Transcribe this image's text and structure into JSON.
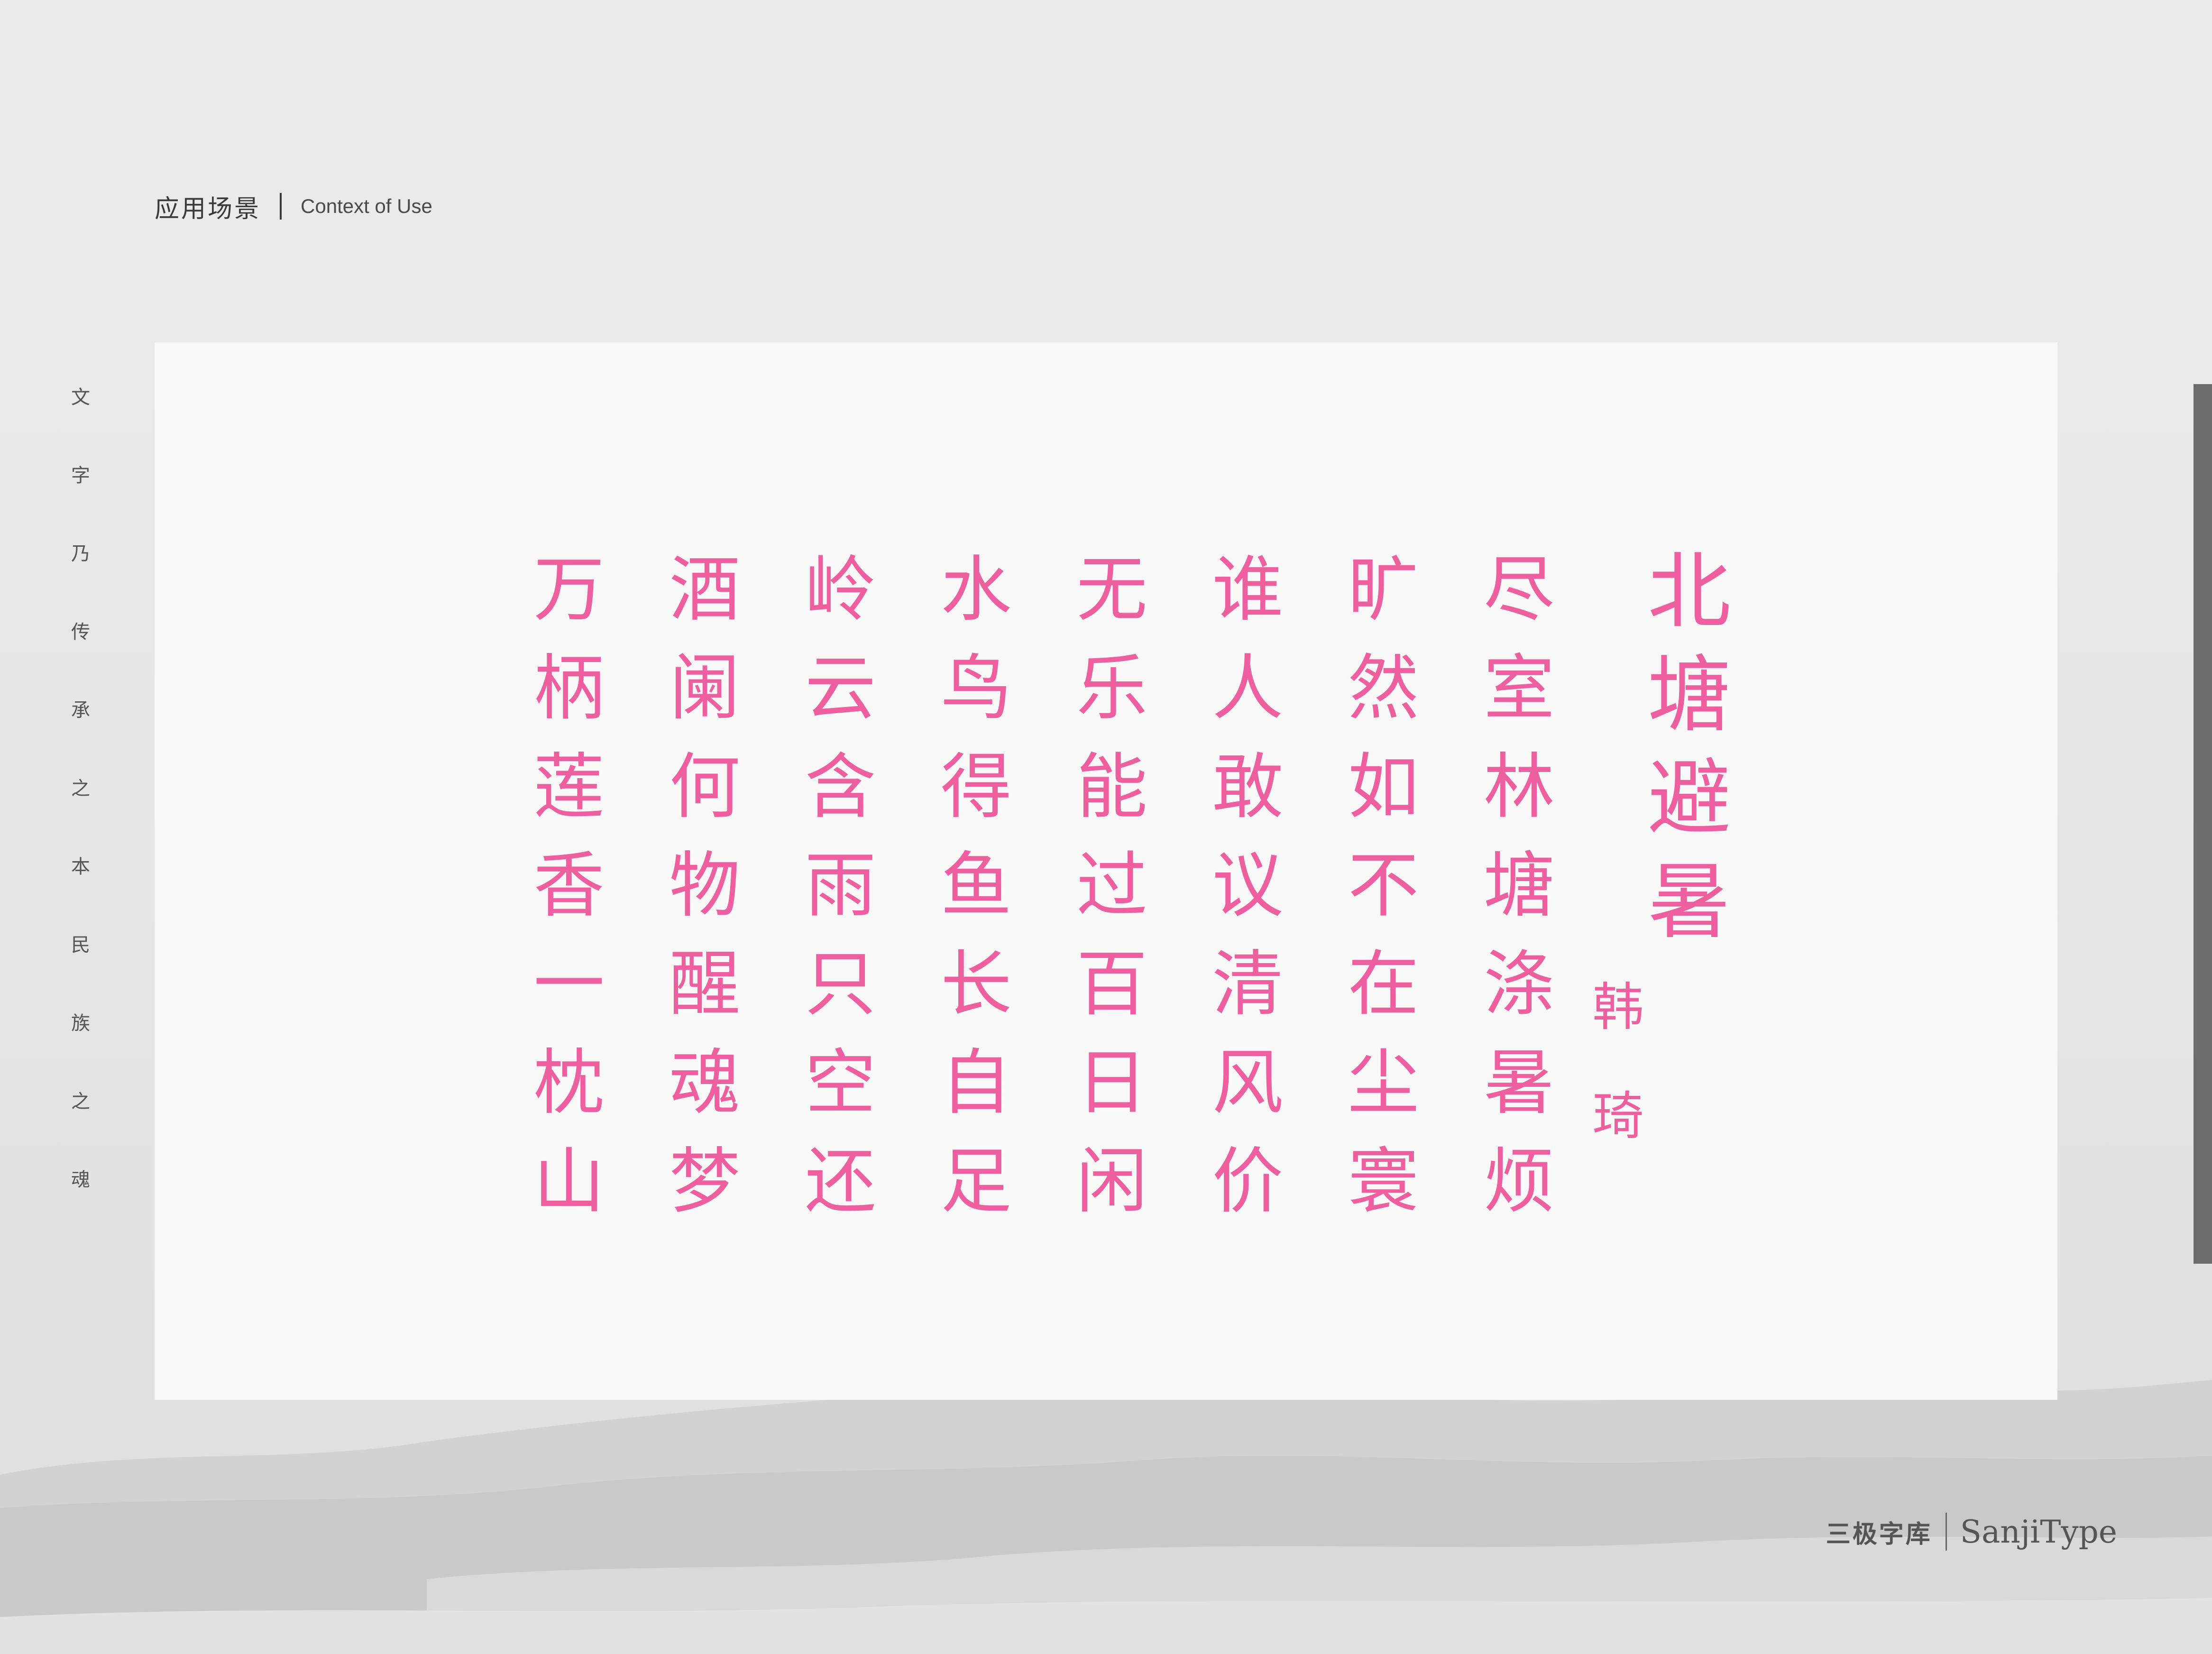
{
  "header": {
    "title_cn": "应用场景",
    "title_en": "Context of Use"
  },
  "vertical_motto": [
    "文",
    "字",
    "乃",
    "传",
    "承",
    "之",
    "本",
    "民",
    "族",
    "之",
    "魂"
  ],
  "poem": {
    "title": [
      "北",
      "塘",
      "避",
      "暑"
    ],
    "author": [
      "韩",
      "琦"
    ],
    "columns": [
      [
        "尽",
        "室",
        "林",
        "塘",
        "涤",
        "暑",
        "烦"
      ],
      [
        "旷",
        "然",
        "如",
        "不",
        "在",
        "尘",
        "寰"
      ],
      [
        "谁",
        "人",
        "敢",
        "议",
        "清",
        "风",
        "价"
      ],
      [
        "无",
        "乐",
        "能",
        "过",
        "百",
        "日",
        "闲"
      ],
      [
        "水",
        "鸟",
        "得",
        "鱼",
        "长",
        "自",
        "足"
      ],
      [
        "岭",
        "云",
        "含",
        "雨",
        "只",
        "空",
        "还"
      ],
      [
        "酒",
        "阑",
        "何",
        "物",
        "醒",
        "魂",
        "梦"
      ],
      [
        "万",
        "柄",
        "莲",
        "香",
        "一",
        "枕",
        "山"
      ]
    ]
  },
  "footer": {
    "brand_cn": "三极字库",
    "brand_en": "SanjiType"
  },
  "colors": {
    "accent": "#ee5f9f",
    "background": "#e9e9e9",
    "card": "#f8f8f8",
    "scrollbar": "#6d6d6d"
  }
}
